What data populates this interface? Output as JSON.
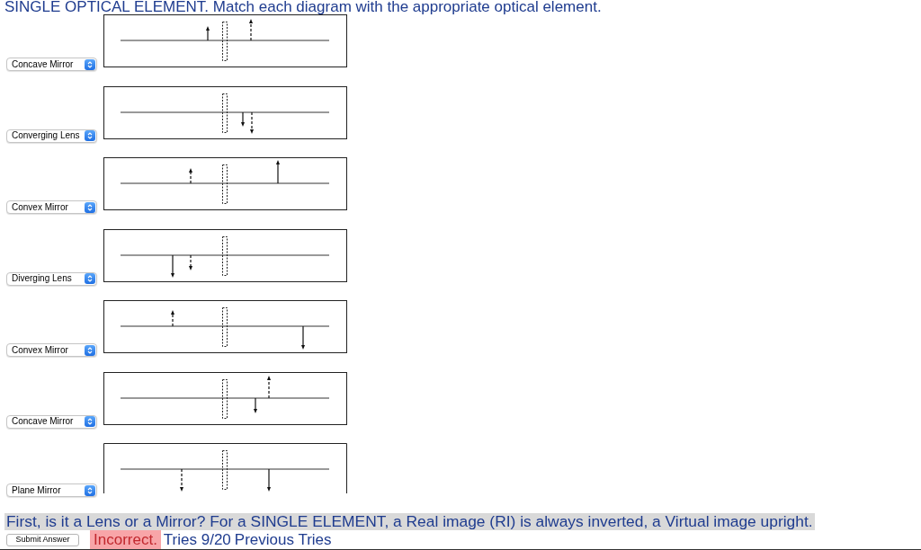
{
  "prompt": "SINGLE OPTICAL ELEMENT. Match each diagram with the appropriate optical element.",
  "items": [
    {
      "value": "Concave Mirror"
    },
    {
      "value": "Converging Lens"
    },
    {
      "value": "Convex Mirror"
    },
    {
      "value": "Diverging Lens"
    },
    {
      "value": "Convex Mirror"
    },
    {
      "value": "Concave Mirror"
    },
    {
      "value": "Plane Mirror"
    }
  ],
  "hint": "First, is it a Lens or a Mirror? For a SINGLE ELEMENT, a Real image (RI) is always inverted, a Virtual image upright.",
  "submit_button": "Submit Answer",
  "feedback": {
    "text": "Incorrect.",
    "correct": false
  },
  "tries": "Tries 9/20",
  "previous_tries_link": "Previous Tries"
}
